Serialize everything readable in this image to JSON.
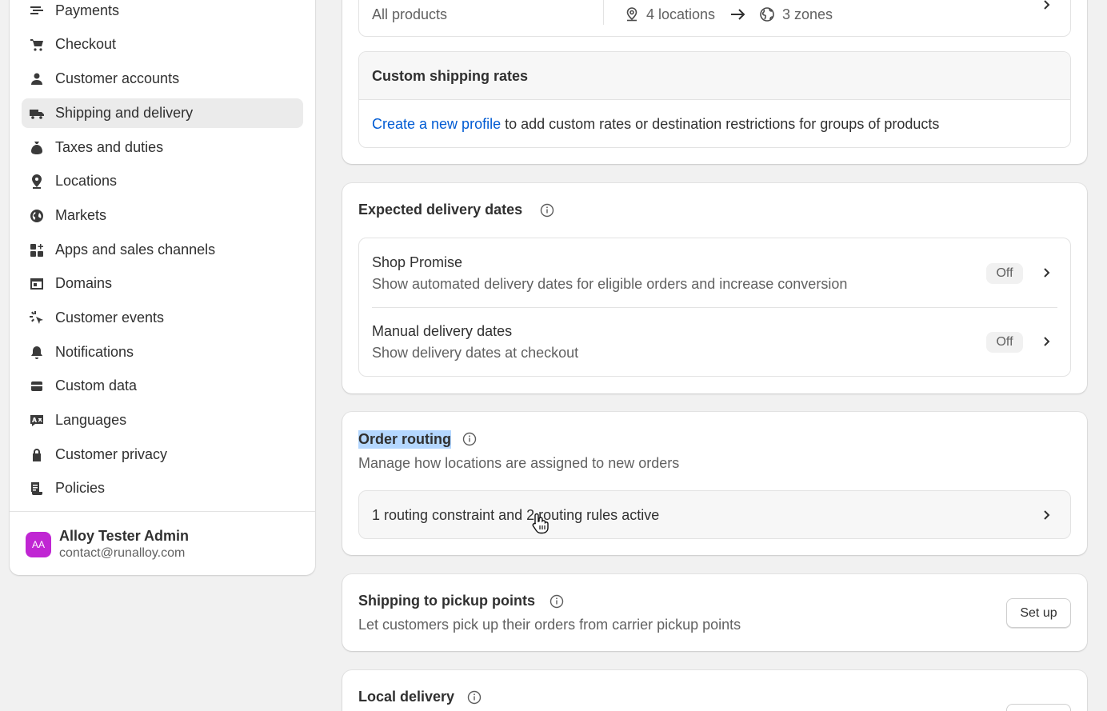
{
  "sidebar": {
    "items": [
      {
        "label": "Payments",
        "icon": "payments-icon"
      },
      {
        "label": "Checkout",
        "icon": "cart-icon"
      },
      {
        "label": "Customer accounts",
        "icon": "person-icon"
      },
      {
        "label": "Shipping and delivery",
        "icon": "truck-icon",
        "active": true
      },
      {
        "label": "Taxes and duties",
        "icon": "money-bag-icon"
      },
      {
        "label": "Locations",
        "icon": "location-pin-icon"
      },
      {
        "label": "Markets",
        "icon": "globe-icon"
      },
      {
        "label": "Apps and sales channels",
        "icon": "apps-icon"
      },
      {
        "label": "Domains",
        "icon": "domain-icon"
      },
      {
        "label": "Customer events",
        "icon": "cursor-click-icon"
      },
      {
        "label": "Notifications",
        "icon": "bell-icon"
      },
      {
        "label": "Custom data",
        "icon": "database-icon"
      },
      {
        "label": "Languages",
        "icon": "language-icon"
      },
      {
        "label": "Customer privacy",
        "icon": "lock-icon"
      },
      {
        "label": "Policies",
        "icon": "policy-icon"
      }
    ],
    "user": {
      "initials": "AA",
      "name": "Alloy Tester Admin",
      "email": "contact@runalloy.com"
    }
  },
  "shipping_profile": {
    "products": "All products",
    "locations": "4 locations",
    "zones": "3 zones"
  },
  "custom_rates": {
    "title": "Custom shipping rates",
    "link": "Create a new profile",
    "text": " to add custom rates or destination restrictions for groups of products"
  },
  "expected_delivery": {
    "title": "Expected delivery dates",
    "rows": [
      {
        "title": "Shop Promise",
        "desc": "Show automated delivery dates for eligible orders and increase conversion",
        "status": "Off"
      },
      {
        "title": "Manual delivery dates",
        "desc": "Show delivery dates at checkout",
        "status": "Off"
      }
    ]
  },
  "order_routing": {
    "title": "Order routing",
    "desc": "Manage how locations are assigned to new orders",
    "summary": "1 routing constraint and 2 routing rules active"
  },
  "pickup_points": {
    "title": "Shipping to pickup points",
    "desc": "Let customers pick up their orders from carrier pickup points",
    "button": "Set up"
  },
  "local_delivery": {
    "title": "Local delivery"
  },
  "colors": {
    "link": "#005bd3",
    "highlight": "#b4d7ff",
    "avatar": "#c026d3"
  }
}
